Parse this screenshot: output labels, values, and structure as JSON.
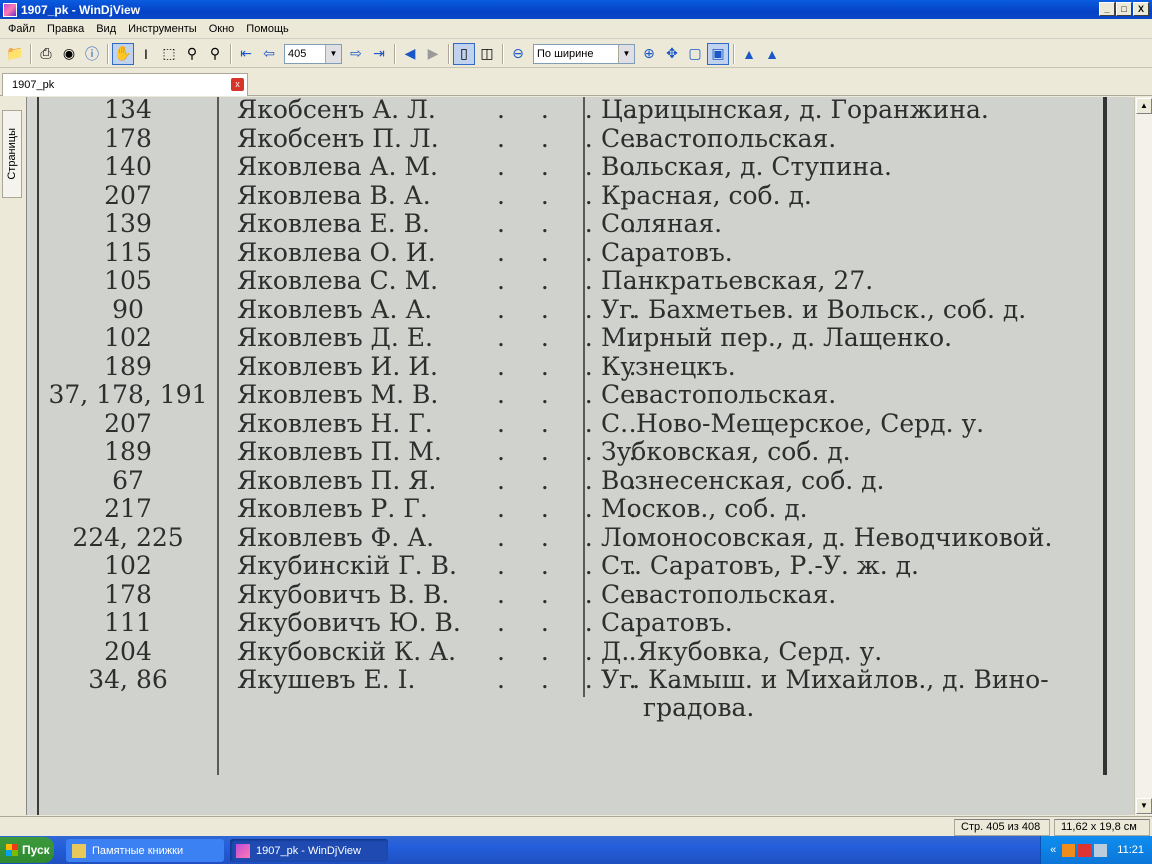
{
  "window": {
    "title": "1907_pk - WinDjView",
    "min_label": "_",
    "max_label": "□",
    "close_label": "X"
  },
  "menu": [
    "Файл",
    "Правка",
    "Вид",
    "Инструменты",
    "Окно",
    "Помощь"
  ],
  "toolbar": {
    "page_number": "405",
    "zoom_mode": "По ширине"
  },
  "tab": {
    "label": "1907_pk",
    "close_label": "x"
  },
  "sidebar": {
    "tab_label": "Страницы"
  },
  "document": {
    "rows": [
      {
        "num": "134",
        "name": "Якобсенъ А. Л.",
        "dots": ". . . .",
        "addr": "Царицынская, д. Горанжина."
      },
      {
        "num": "178",
        "name": "Якобсенъ П. Л.",
        "dots": ". . . .",
        "addr": "Севастопольская."
      },
      {
        "num": "140",
        "name": "Яковлева А. М.",
        "dots": ". . . .",
        "addr": "Вольская, д. Ступина."
      },
      {
        "num": "207",
        "name": "Яковлева В. А.",
        "dots": ". . . .",
        "addr": "Красная, соб. д."
      },
      {
        "num": "139",
        "name": "Яковлева Е. В.",
        "dots": ". . . .",
        "addr": "Соляная."
      },
      {
        "num": "115",
        "name": "Яковлева О. И.",
        "dots": ". . . .",
        "addr": "Саратовъ."
      },
      {
        "num": "105",
        "name": "Яковлева С. М.",
        "dots": ". . . .",
        "addr": "Панкратьевская, 27."
      },
      {
        "num": "90",
        "name": "Яковлевъ А. А.",
        "dots": ". . . .",
        "addr": "Уг. Бахметьев. и Вольск., соб. д."
      },
      {
        "num": "102",
        "name": "Яковлевъ Д. Е.",
        "dots": ". . . .",
        "addr": "Мирный пер., д. Лащенко."
      },
      {
        "num": "189",
        "name": "Яковлевъ И. И.",
        "dots": ". . . .",
        "addr": "Кузнецкъ."
      },
      {
        "num": "37, 178, 191",
        "name": "Яковлевъ М. В.",
        "dots": ". . . .",
        "addr": "Севастопольская."
      },
      {
        "num": "207",
        "name": "Яковлевъ Н. Г.",
        "dots": ". . . .",
        "addr": "С. Ново-Мещерское, Серд. у."
      },
      {
        "num": "189",
        "name": "Яковлевъ П. М.",
        "dots": ". . . .",
        "addr": "Зубковская, соб. д."
      },
      {
        "num": "67",
        "name": "Яковлевъ П. Я.",
        "dots": ". . . .",
        "addr": "Вознесенская, соб. д."
      },
      {
        "num": "217",
        "name": "Яковлевъ Р. Г.",
        "dots": ". . . .",
        "addr": "Москов., соб. д."
      },
      {
        "num": "224, 225",
        "name": "Яковлевъ Ф. А.",
        "dots": ". . . .",
        "addr": "Ломоносовская, д. Неводчиковой."
      },
      {
        "num": "102",
        "name": "Якубинскій Г. В.",
        "dots": ". . . .",
        "addr": "Ст. Саратовъ, Р.-У. ж. д."
      },
      {
        "num": "178",
        "name": "Якубовичъ В. В.",
        "dots": ". . . .",
        "addr": "Севастопольская."
      },
      {
        "num": "111",
        "name": "Якубовичъ Ю. В.",
        "dots": ". . . .",
        "addr": "Саратовъ."
      },
      {
        "num": "204",
        "name": "Якубовскій К. А.",
        "dots": ". . . .",
        "addr": "Д. Якубовка, Серд. у."
      },
      {
        "num": "34, 86",
        "name": "Якушевъ Е. І.",
        "dots": ". . . . .",
        "addr": "Уг. Камыш. и Михайлов., д. Вино-"
      }
    ],
    "continuation": "градова."
  },
  "status": {
    "page": "Стр. 405 из 408",
    "size": "11,62 x 19,8 см"
  },
  "taskbar": {
    "start_label": "Пуск",
    "tasks": [
      {
        "label": "Памятные книжки"
      },
      {
        "label": "1907_pk - WinDjView"
      }
    ],
    "clock": "11:21",
    "tray_expand": "«"
  }
}
